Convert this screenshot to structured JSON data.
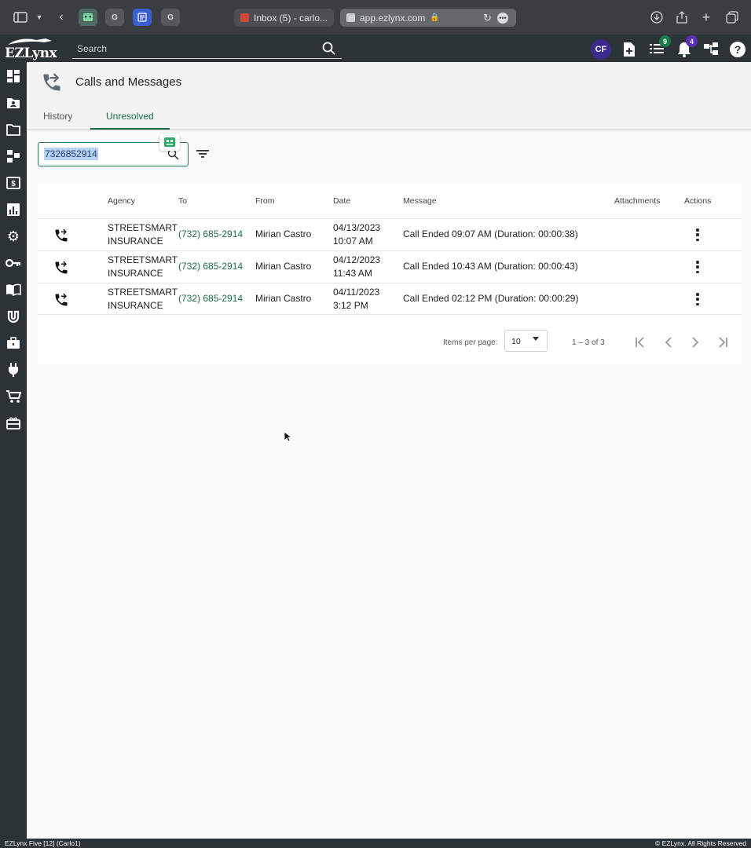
{
  "browser": {
    "tabs": [
      {
        "label": "Inbox (5) - carlo..."
      },
      {
        "label": "app.ezlynx.com"
      }
    ],
    "favicon_letters": [
      "G",
      "G"
    ]
  },
  "header": {
    "logo_text": "EZLynx",
    "search_placeholder": "Search",
    "avatar_initials": "CF",
    "tasks_badge": "9",
    "notifications_badge": "4",
    "colors": {
      "tasks_badge": "#1c7a4a",
      "notifications_badge": "#5b2fb8",
      "avatar": "#3b2a8c"
    }
  },
  "page": {
    "title": "Calls and Messages",
    "tabs": [
      {
        "label": "History",
        "active": false
      },
      {
        "label": "Unresolved",
        "active": true
      }
    ],
    "filter_value": "7326852914"
  },
  "table": {
    "columns": [
      "Agency",
      "To",
      "From",
      "Date",
      "Message",
      "Attachments",
      "Actions"
    ],
    "rows": [
      {
        "agency_line1": "STREETSMART",
        "agency_line2": "INSURANCE",
        "to": "(732) 685-2914",
        "from": "Mirian Castro",
        "date": "04/13/2023",
        "time": "10:07 AM",
        "message": "Call Ended 09:07 AM (Duration: 00:00:38)"
      },
      {
        "agency_line1": "STREETSMART",
        "agency_line2": "INSURANCE",
        "to": "(732) 685-2914",
        "from": "Mirian Castro",
        "date": "04/12/2023",
        "time": "11:43 AM",
        "message": "Call Ended 10:43 AM (Duration: 00:00:43)"
      },
      {
        "agency_line1": "STREETSMART",
        "agency_line2": "INSURANCE",
        "to": "(732) 685-2914",
        "from": "Mirian Castro",
        "date": "04/11/2023",
        "time": "3:12 PM",
        "message": "Call Ended 02:12 PM (Duration: 00:00:29)"
      }
    ]
  },
  "paginator": {
    "items_per_page_label": "Items per page:",
    "items_per_page_value": "10",
    "range_label": "1 – 3 of 3"
  },
  "footer": {
    "left": "EZLynx Five [12] (Carlo1)",
    "right": "© EZLynx. All Rights Reserved"
  },
  "accent_color": "#1c6e45"
}
